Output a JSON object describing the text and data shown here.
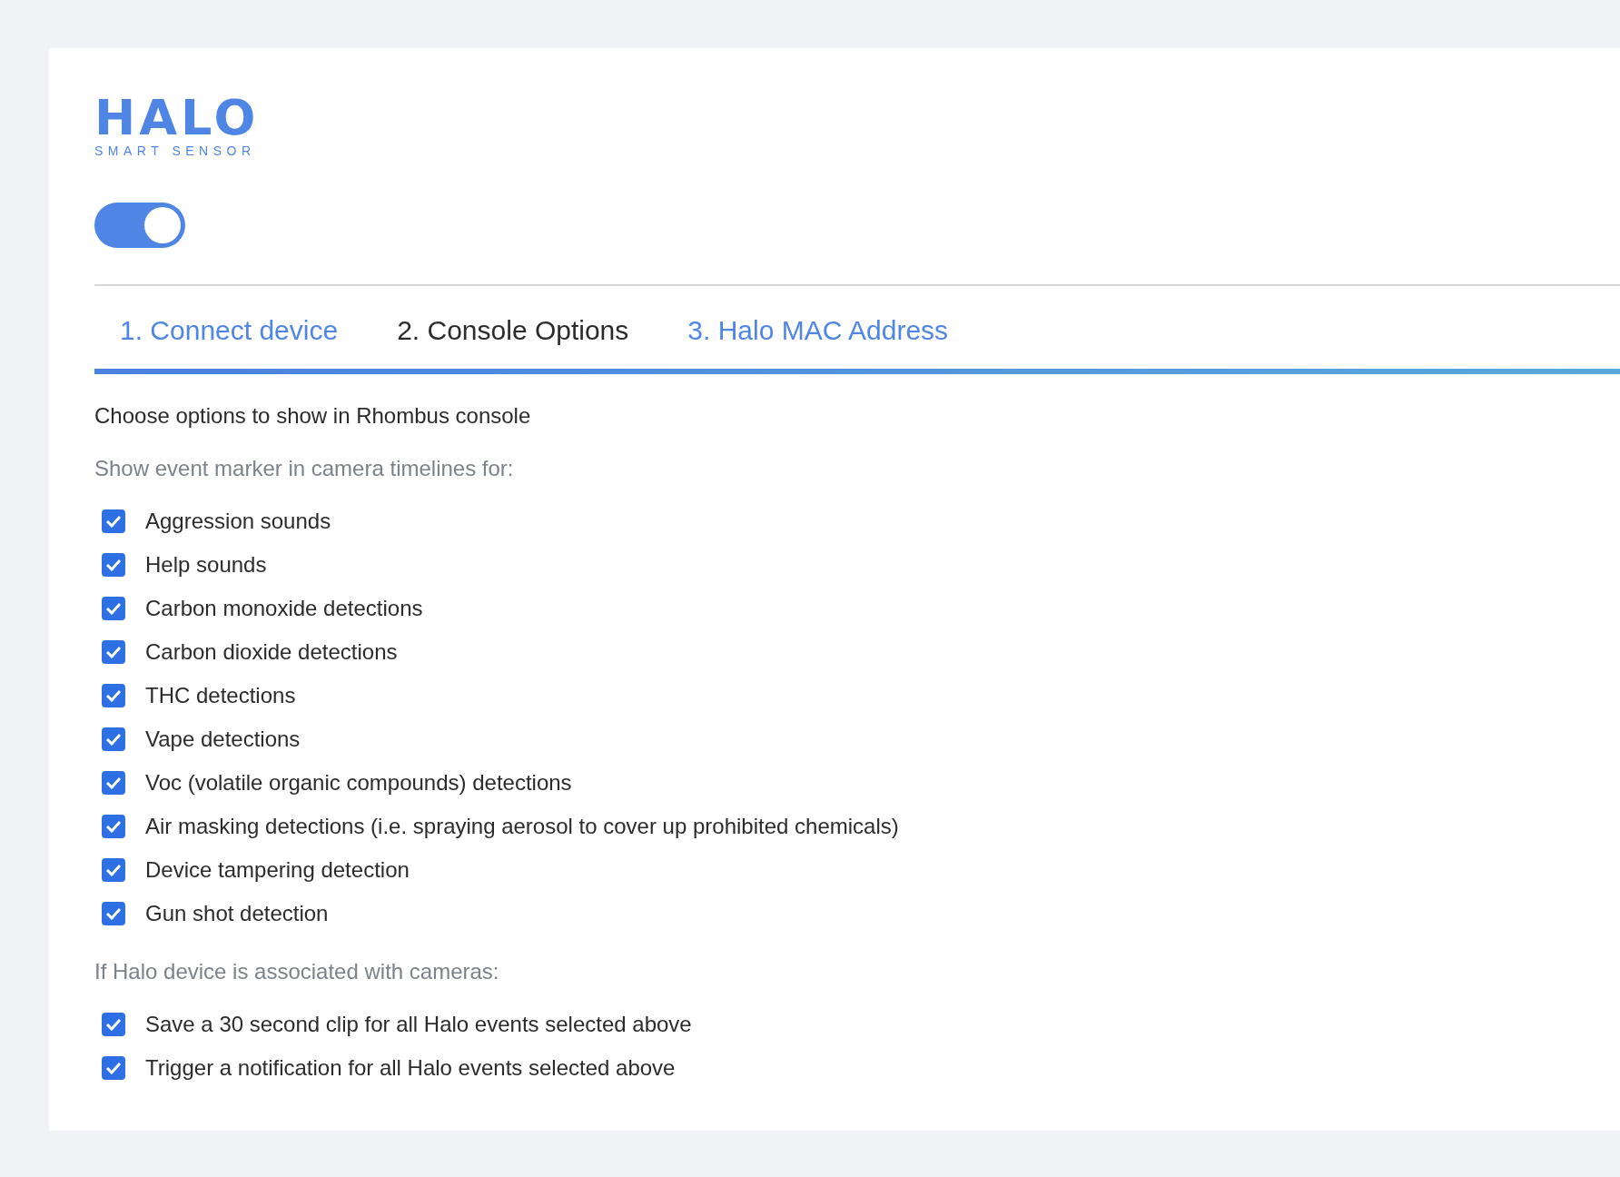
{
  "logo": {
    "title": "HALO",
    "subtitle": "SMART SENSOR"
  },
  "toggle": {
    "on": true
  },
  "tabs": [
    {
      "label": "1. Connect device",
      "selected": false
    },
    {
      "label": "2. Console Options",
      "selected": true
    },
    {
      "label": "3. Halo MAC Address",
      "selected": false
    }
  ],
  "intro": "Choose options to show in Rhombus console",
  "sections": [
    {
      "heading": "Show event marker in camera timelines for:",
      "options": [
        {
          "label": "Aggression sounds",
          "checked": true
        },
        {
          "label": "Help sounds",
          "checked": true
        },
        {
          "label": "Carbon monoxide detections",
          "checked": true
        },
        {
          "label": "Carbon dioxide detections",
          "checked": true
        },
        {
          "label": "THC detections",
          "checked": true
        },
        {
          "label": "Vape detections",
          "checked": true
        },
        {
          "label": "Voc (volatile organic compounds) detections",
          "checked": true
        },
        {
          "label": "Air masking detections (i.e. spraying aerosol to cover up prohibited chemicals)",
          "checked": true
        },
        {
          "label": "Device tampering detection",
          "checked": true
        },
        {
          "label": "Gun shot detection",
          "checked": true
        }
      ]
    },
    {
      "heading": "If Halo device is associated with cameras:",
      "options": [
        {
          "label": "Save a 30 second clip for all Halo events selected above",
          "checked": true
        },
        {
          "label": "Trigger a notification for all Halo events selected above",
          "checked": true
        }
      ]
    }
  ]
}
